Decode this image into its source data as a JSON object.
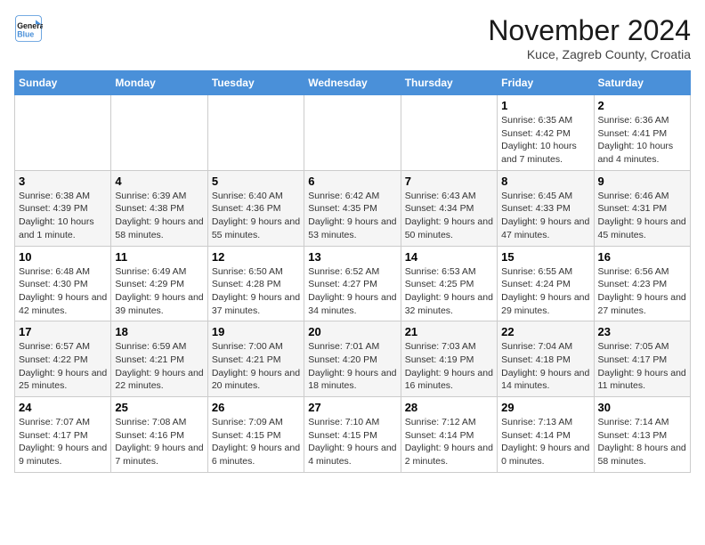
{
  "header": {
    "logo_line1": "General",
    "logo_line2": "Blue",
    "month": "November 2024",
    "location": "Kuce, Zagreb County, Croatia"
  },
  "days_of_week": [
    "Sunday",
    "Monday",
    "Tuesday",
    "Wednesday",
    "Thursday",
    "Friday",
    "Saturday"
  ],
  "weeks": [
    [
      {
        "day": "",
        "info": ""
      },
      {
        "day": "",
        "info": ""
      },
      {
        "day": "",
        "info": ""
      },
      {
        "day": "",
        "info": ""
      },
      {
        "day": "",
        "info": ""
      },
      {
        "day": "1",
        "info": "Sunrise: 6:35 AM\nSunset: 4:42 PM\nDaylight: 10 hours and 7 minutes."
      },
      {
        "day": "2",
        "info": "Sunrise: 6:36 AM\nSunset: 4:41 PM\nDaylight: 10 hours and 4 minutes."
      }
    ],
    [
      {
        "day": "3",
        "info": "Sunrise: 6:38 AM\nSunset: 4:39 PM\nDaylight: 10 hours and 1 minute."
      },
      {
        "day": "4",
        "info": "Sunrise: 6:39 AM\nSunset: 4:38 PM\nDaylight: 9 hours and 58 minutes."
      },
      {
        "day": "5",
        "info": "Sunrise: 6:40 AM\nSunset: 4:36 PM\nDaylight: 9 hours and 55 minutes."
      },
      {
        "day": "6",
        "info": "Sunrise: 6:42 AM\nSunset: 4:35 PM\nDaylight: 9 hours and 53 minutes."
      },
      {
        "day": "7",
        "info": "Sunrise: 6:43 AM\nSunset: 4:34 PM\nDaylight: 9 hours and 50 minutes."
      },
      {
        "day": "8",
        "info": "Sunrise: 6:45 AM\nSunset: 4:33 PM\nDaylight: 9 hours and 47 minutes."
      },
      {
        "day": "9",
        "info": "Sunrise: 6:46 AM\nSunset: 4:31 PM\nDaylight: 9 hours and 45 minutes."
      }
    ],
    [
      {
        "day": "10",
        "info": "Sunrise: 6:48 AM\nSunset: 4:30 PM\nDaylight: 9 hours and 42 minutes."
      },
      {
        "day": "11",
        "info": "Sunrise: 6:49 AM\nSunset: 4:29 PM\nDaylight: 9 hours and 39 minutes."
      },
      {
        "day": "12",
        "info": "Sunrise: 6:50 AM\nSunset: 4:28 PM\nDaylight: 9 hours and 37 minutes."
      },
      {
        "day": "13",
        "info": "Sunrise: 6:52 AM\nSunset: 4:27 PM\nDaylight: 9 hours and 34 minutes."
      },
      {
        "day": "14",
        "info": "Sunrise: 6:53 AM\nSunset: 4:25 PM\nDaylight: 9 hours and 32 minutes."
      },
      {
        "day": "15",
        "info": "Sunrise: 6:55 AM\nSunset: 4:24 PM\nDaylight: 9 hours and 29 minutes."
      },
      {
        "day": "16",
        "info": "Sunrise: 6:56 AM\nSunset: 4:23 PM\nDaylight: 9 hours and 27 minutes."
      }
    ],
    [
      {
        "day": "17",
        "info": "Sunrise: 6:57 AM\nSunset: 4:22 PM\nDaylight: 9 hours and 25 minutes."
      },
      {
        "day": "18",
        "info": "Sunrise: 6:59 AM\nSunset: 4:21 PM\nDaylight: 9 hours and 22 minutes."
      },
      {
        "day": "19",
        "info": "Sunrise: 7:00 AM\nSunset: 4:21 PM\nDaylight: 9 hours and 20 minutes."
      },
      {
        "day": "20",
        "info": "Sunrise: 7:01 AM\nSunset: 4:20 PM\nDaylight: 9 hours and 18 minutes."
      },
      {
        "day": "21",
        "info": "Sunrise: 7:03 AM\nSunset: 4:19 PM\nDaylight: 9 hours and 16 minutes."
      },
      {
        "day": "22",
        "info": "Sunrise: 7:04 AM\nSunset: 4:18 PM\nDaylight: 9 hours and 14 minutes."
      },
      {
        "day": "23",
        "info": "Sunrise: 7:05 AM\nSunset: 4:17 PM\nDaylight: 9 hours and 11 minutes."
      }
    ],
    [
      {
        "day": "24",
        "info": "Sunrise: 7:07 AM\nSunset: 4:17 PM\nDaylight: 9 hours and 9 minutes."
      },
      {
        "day": "25",
        "info": "Sunrise: 7:08 AM\nSunset: 4:16 PM\nDaylight: 9 hours and 7 minutes."
      },
      {
        "day": "26",
        "info": "Sunrise: 7:09 AM\nSunset: 4:15 PM\nDaylight: 9 hours and 6 minutes."
      },
      {
        "day": "27",
        "info": "Sunrise: 7:10 AM\nSunset: 4:15 PM\nDaylight: 9 hours and 4 minutes."
      },
      {
        "day": "28",
        "info": "Sunrise: 7:12 AM\nSunset: 4:14 PM\nDaylight: 9 hours and 2 minutes."
      },
      {
        "day": "29",
        "info": "Sunrise: 7:13 AM\nSunset: 4:14 PM\nDaylight: 9 hours and 0 minutes."
      },
      {
        "day": "30",
        "info": "Sunrise: 7:14 AM\nSunset: 4:13 PM\nDaylight: 8 hours and 58 minutes."
      }
    ]
  ]
}
